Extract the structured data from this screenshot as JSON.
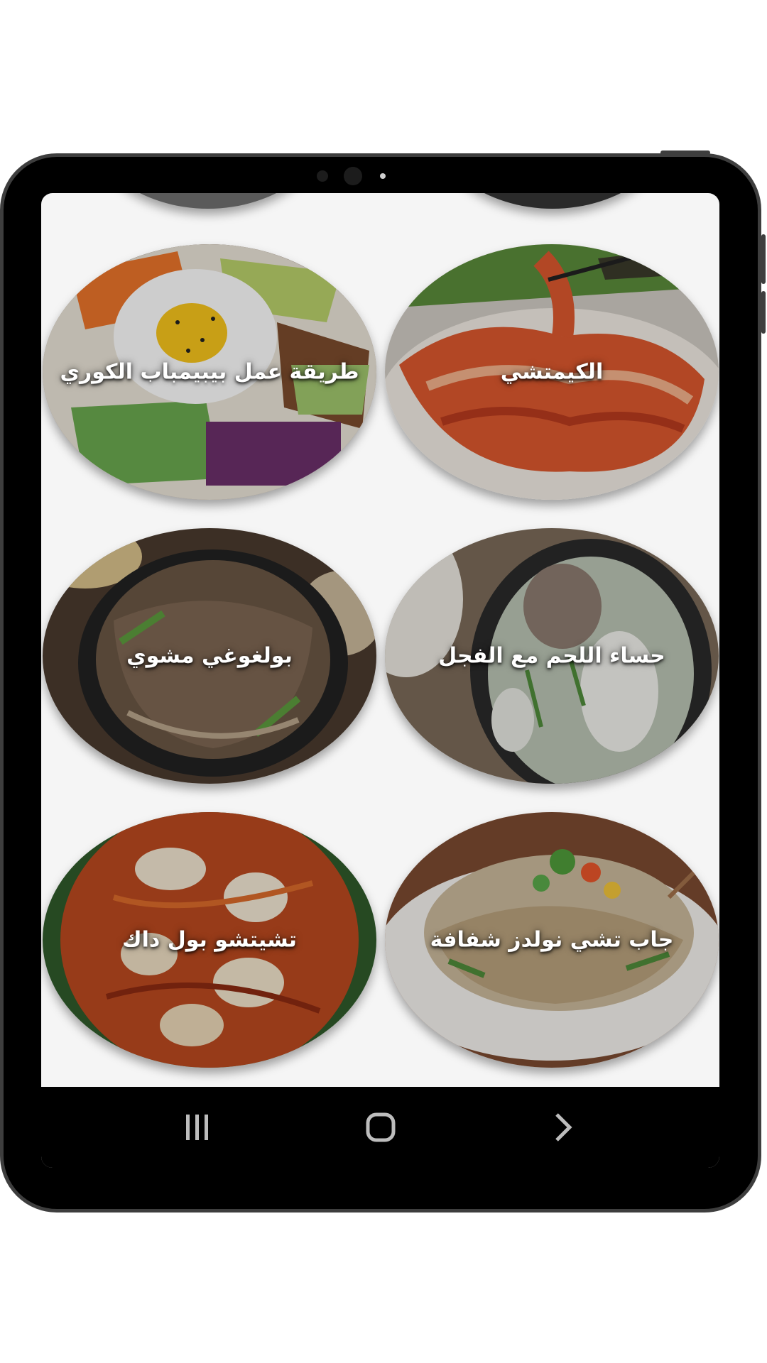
{
  "recipes": [
    {
      "title": "طريقة عمل بيبيمباب الكوري",
      "image": "bibimbap-bowl"
    },
    {
      "title": "الكيمتشي",
      "image": "kimchi-plate"
    },
    {
      "title": "بولغوغي مشوي",
      "image": "bulgogi-pan"
    },
    {
      "title": "حساء اللحم مع الفجل",
      "image": "beef-radish-soup"
    },
    {
      "title": "تشيتشو بول داك",
      "image": "kimchi-stir-fry"
    },
    {
      "title": "جاب تشي نولدز شفافة",
      "image": "japchae-noodles"
    }
  ],
  "navbar": {
    "recents_icon": "recents-icon",
    "home_icon": "home-icon",
    "back_icon": "chevron-right-icon"
  },
  "colors": {
    "frame": "#000000",
    "bezel": "#3e3e3e",
    "screen_bg": "#f5f5f5"
  }
}
